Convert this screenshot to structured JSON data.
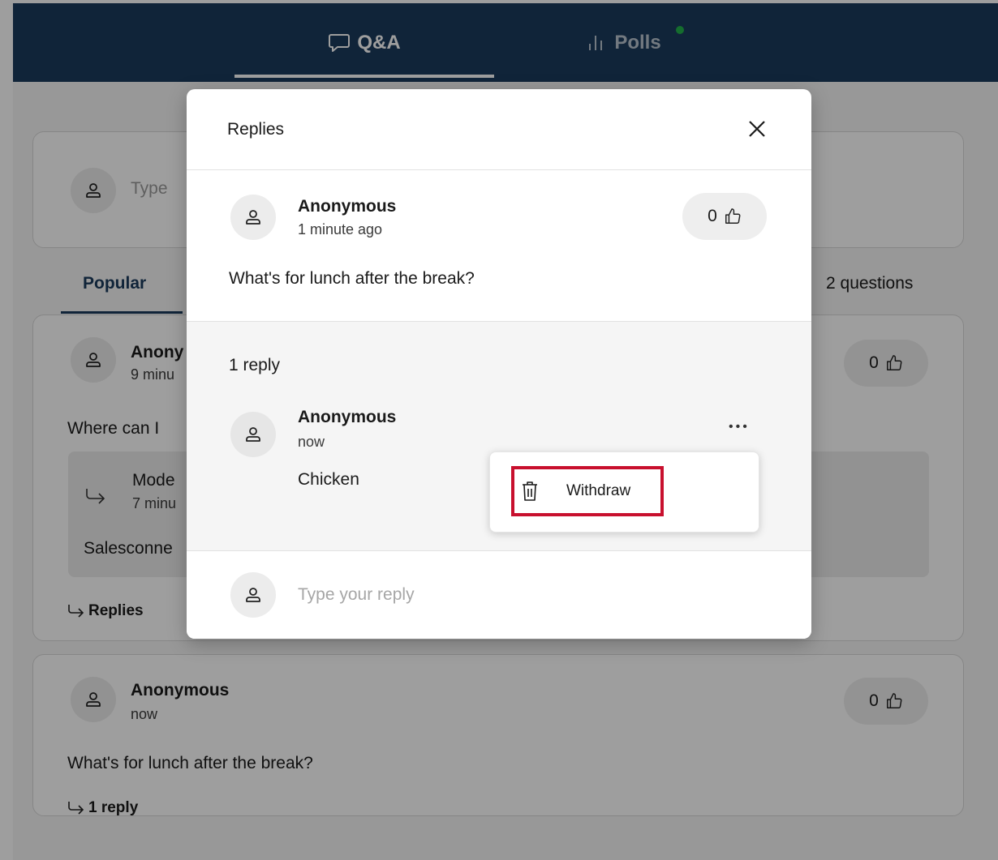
{
  "tabs": {
    "qa_label": "Q&A",
    "polls_label": "Polls"
  },
  "background": {
    "ask_placeholder": "Type",
    "sort_tab_popular": "Popular",
    "question_count": "2 questions",
    "question1": {
      "author": "Anony",
      "time": "9 minu",
      "text": "Where can I",
      "reply_author": "Mode",
      "reply_time": "7 minu",
      "reply_text": "Salesconne",
      "likes": "0",
      "replies_link": "Replies"
    },
    "question2": {
      "author": "Anonymous",
      "time": "now",
      "text": "What's for lunch after the break?",
      "likes": "0",
      "replies_link": "1 reply"
    }
  },
  "modal": {
    "title": "Replies",
    "question": {
      "author": "Anonymous",
      "time": "1 minute ago",
      "text": "What's for lunch after the break?",
      "likes": "0"
    },
    "reply_count": "1 reply",
    "reply": {
      "author": "Anonymous",
      "time": "now",
      "text": "Chicken",
      "more_label": "•••"
    },
    "menu": {
      "withdraw_label": "Withdraw",
      "highlight_color": "#c8102e"
    },
    "reply_input": {
      "placeholder": "Type your reply"
    }
  },
  "colors": {
    "header_bg": "#1a3a5c",
    "accent": "#1a3a5c",
    "polls_dot": "#22b04b"
  }
}
